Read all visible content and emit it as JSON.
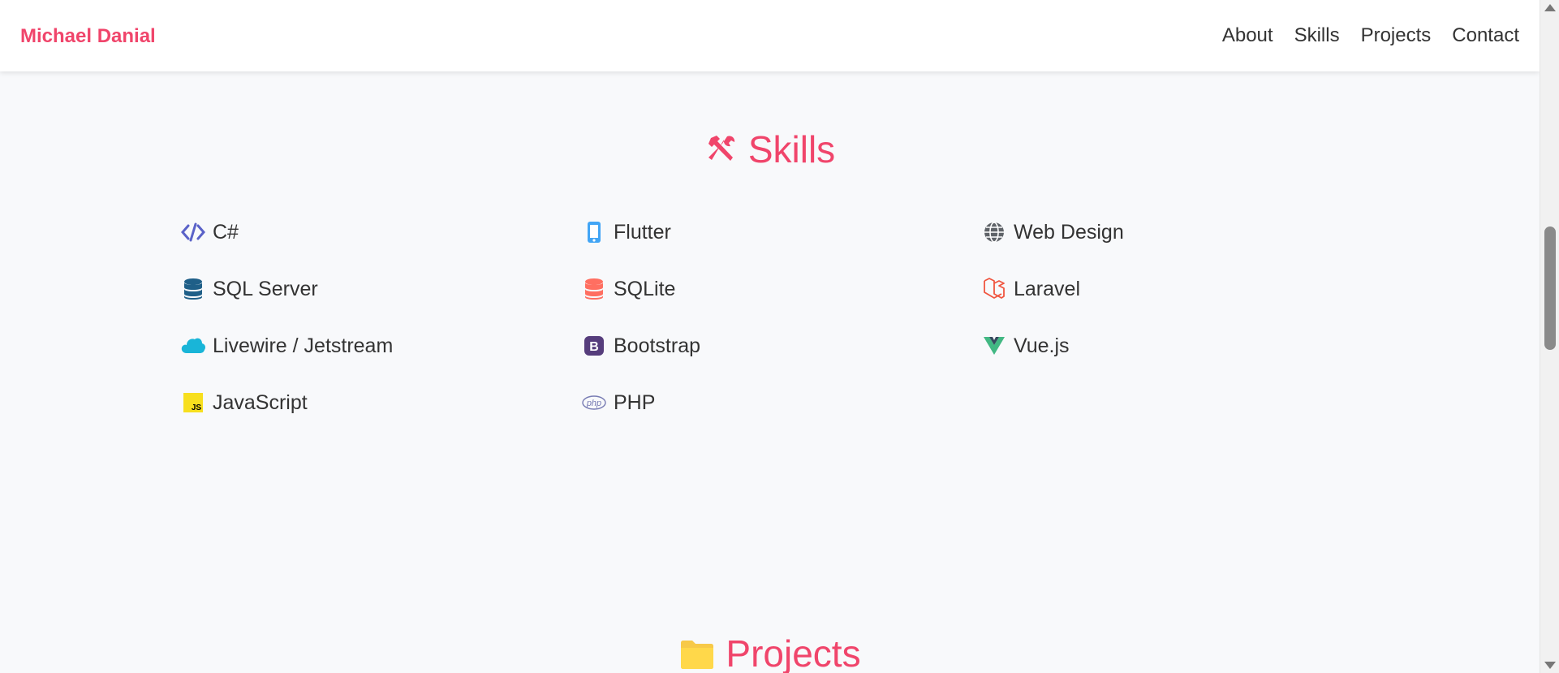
{
  "header": {
    "brand": "Michael Danial",
    "nav": [
      {
        "label": "About"
      },
      {
        "label": "Skills"
      },
      {
        "label": "Projects"
      },
      {
        "label": "Contact"
      }
    ]
  },
  "skills": {
    "title": "Skills",
    "title_icon": "tools-icon",
    "items": [
      {
        "label": "C#",
        "icon": "code-icon",
        "color": "#5a62c8"
      },
      {
        "label": "Flutter",
        "icon": "mobile-icon",
        "color": "#42a5f5"
      },
      {
        "label": "Web Design",
        "icon": "globe-icon",
        "color": "#5f6368"
      },
      {
        "label": "SQL Server",
        "icon": "database-icon",
        "color": "#1f5f88"
      },
      {
        "label": "SQLite",
        "icon": "database-icon",
        "color": "#ff6f61"
      },
      {
        "label": "Laravel",
        "icon": "laravel-icon",
        "color": "#f0553f"
      },
      {
        "label": "Livewire / Jetstream",
        "icon": "cloud-icon",
        "color": "#19b5d8"
      },
      {
        "label": "Bootstrap",
        "icon": "bootstrap-icon",
        "color": "#563d7c"
      },
      {
        "label": "Vue.js",
        "icon": "vue-icon",
        "color": "#42b883"
      },
      {
        "label": "JavaScript",
        "icon": "javascript-icon",
        "color": "#f7df1e"
      },
      {
        "label": "PHP",
        "icon": "php-icon",
        "color": "#777bb3"
      }
    ]
  },
  "projects": {
    "title": "Projects",
    "title_icon": "folder-icon"
  },
  "colors": {
    "accent": "#f0456b",
    "text": "#333333",
    "background": "#f8f9fb"
  }
}
